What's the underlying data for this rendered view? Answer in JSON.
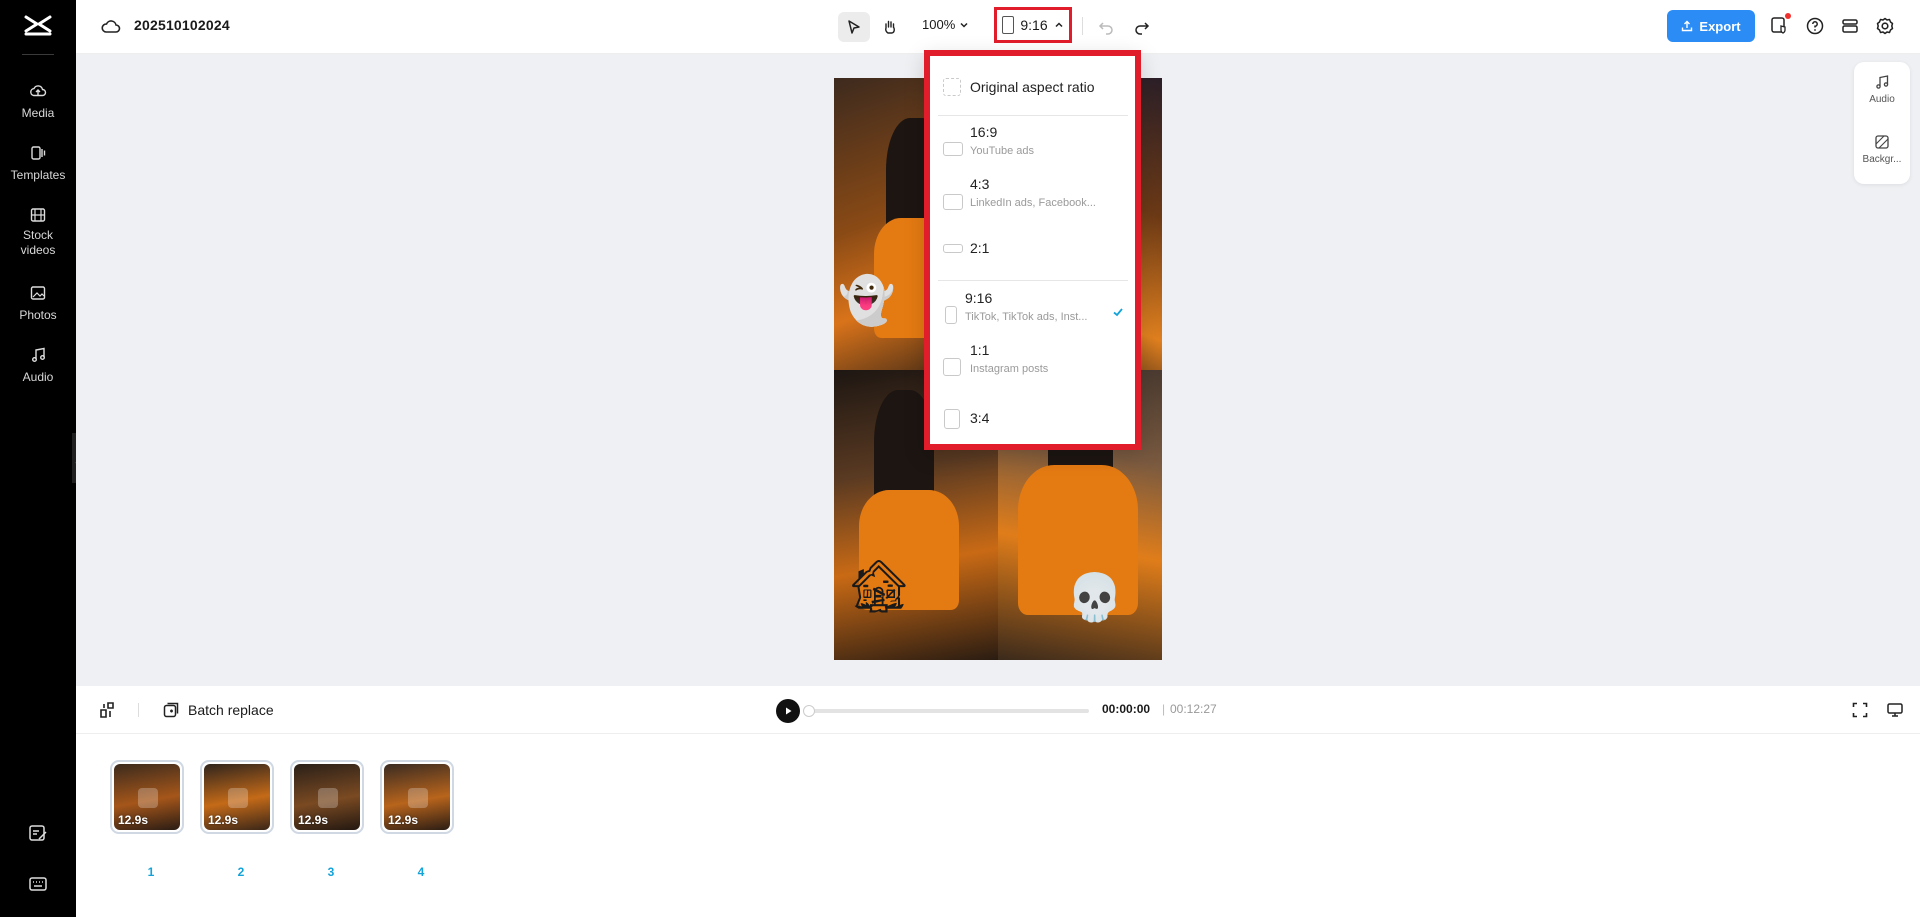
{
  "app": {
    "project_title": "202510102024"
  },
  "sidebar": {
    "items": [
      {
        "label": "Media",
        "icon": "cloud-upload-icon"
      },
      {
        "label": "Templates",
        "icon": "templates-icon"
      },
      {
        "label": "Stock videos",
        "icon": "film-icon"
      },
      {
        "label": "Photos",
        "icon": "image-icon"
      },
      {
        "label": "Audio",
        "icon": "music-icon"
      }
    ]
  },
  "toolbar": {
    "zoom": "100%",
    "ratio": "9:16",
    "export_label": "Export"
  },
  "right_panel": {
    "items": [
      {
        "label": "Audio",
        "icon": "music-icon"
      },
      {
        "label": "Backgr...",
        "icon": "background-icon"
      }
    ]
  },
  "ratio_menu": {
    "original": "Original aspect ratio",
    "options": [
      {
        "name": "16:9",
        "sub": "YouTube ads",
        "selected": false
      },
      {
        "name": "4:3",
        "sub": "LinkedIn ads, Facebook...",
        "selected": false
      },
      {
        "name": "2:1",
        "sub": "",
        "selected": false
      },
      {
        "name": "9:16",
        "sub": "TikTok, TikTok ads, Inst...",
        "selected": true
      },
      {
        "name": "1:1",
        "sub": "Instagram posts",
        "selected": false
      },
      {
        "name": "3:4",
        "sub": "",
        "selected": false
      }
    ]
  },
  "playback": {
    "batch_replace": "Batch replace",
    "current_time": "00:00:00",
    "separator": "|",
    "total_time": "00:12:27"
  },
  "timeline": {
    "clips": [
      {
        "duration": "12.9s",
        "index": "1"
      },
      {
        "duration": "12.9s",
        "index": "2"
      },
      {
        "duration": "12.9s",
        "index": "3"
      },
      {
        "duration": "12.9s",
        "index": "4"
      }
    ]
  },
  "colors": {
    "accent": "#2b8cf5",
    "highlight": "#e11d2b",
    "check": "#13a3d9"
  }
}
